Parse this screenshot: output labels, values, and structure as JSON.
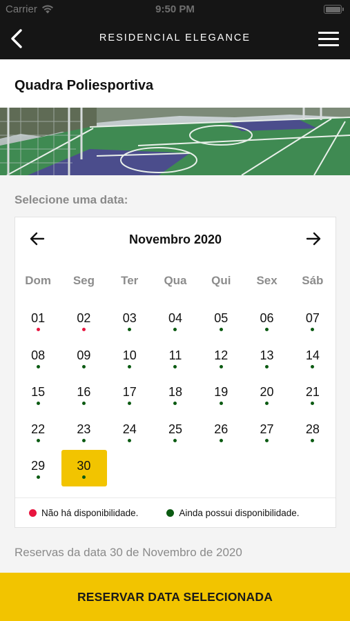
{
  "status_bar": {
    "carrier": "Carrier",
    "time": "9:50 PM",
    "icons": [
      "wifi-icon",
      "battery-icon"
    ]
  },
  "navbar": {
    "title": "RESIDENCIAL ELEGANCE",
    "icons": [
      "back-arrow-icon",
      "hamburger-menu-icon"
    ]
  },
  "page": {
    "title": "Quadra Poliesportiva",
    "select_label": "Selecione uma data:"
  },
  "calendar": {
    "month_label": "Novembro 2020",
    "weekdays": [
      "Dom",
      "Seg",
      "Ter",
      "Qua",
      "Qui",
      "Sex",
      "Sáb"
    ],
    "selected_day": "30",
    "days": [
      {
        "label": "01",
        "status": "unavailable"
      },
      {
        "label": "02",
        "status": "unavailable"
      },
      {
        "label": "03",
        "status": "available"
      },
      {
        "label": "04",
        "status": "available"
      },
      {
        "label": "05",
        "status": "available"
      },
      {
        "label": "06",
        "status": "available"
      },
      {
        "label": "07",
        "status": "available"
      },
      {
        "label": "08",
        "status": "available"
      },
      {
        "label": "09",
        "status": "available"
      },
      {
        "label": "10",
        "status": "available"
      },
      {
        "label": "11",
        "status": "available"
      },
      {
        "label": "12",
        "status": "available"
      },
      {
        "label": "13",
        "status": "available"
      },
      {
        "label": "14",
        "status": "available"
      },
      {
        "label": "15",
        "status": "available"
      },
      {
        "label": "16",
        "status": "available"
      },
      {
        "label": "17",
        "status": "available"
      },
      {
        "label": "18",
        "status": "available"
      },
      {
        "label": "19",
        "status": "available"
      },
      {
        "label": "20",
        "status": "available"
      },
      {
        "label": "21",
        "status": "available"
      },
      {
        "label": "22",
        "status": "available"
      },
      {
        "label": "23",
        "status": "available"
      },
      {
        "label": "24",
        "status": "available"
      },
      {
        "label": "25",
        "status": "available"
      },
      {
        "label": "26",
        "status": "available"
      },
      {
        "label": "27",
        "status": "available"
      },
      {
        "label": "28",
        "status": "available"
      },
      {
        "label": "29",
        "status": "available"
      },
      {
        "label": "30",
        "status": "available"
      }
    ],
    "legend": {
      "unavailable": "Não há disponibilidade.",
      "available": "Ainda possui disponibilidade."
    }
  },
  "reservations_label": "Reservas da data 30 de Novembro de 2020",
  "cta_label": "RESERVAR DATA SELECIONADA",
  "colors": {
    "accent": "#f2c400",
    "unavailable": "#e8163f",
    "available": "#0b5a12",
    "navbar": "#151515"
  }
}
